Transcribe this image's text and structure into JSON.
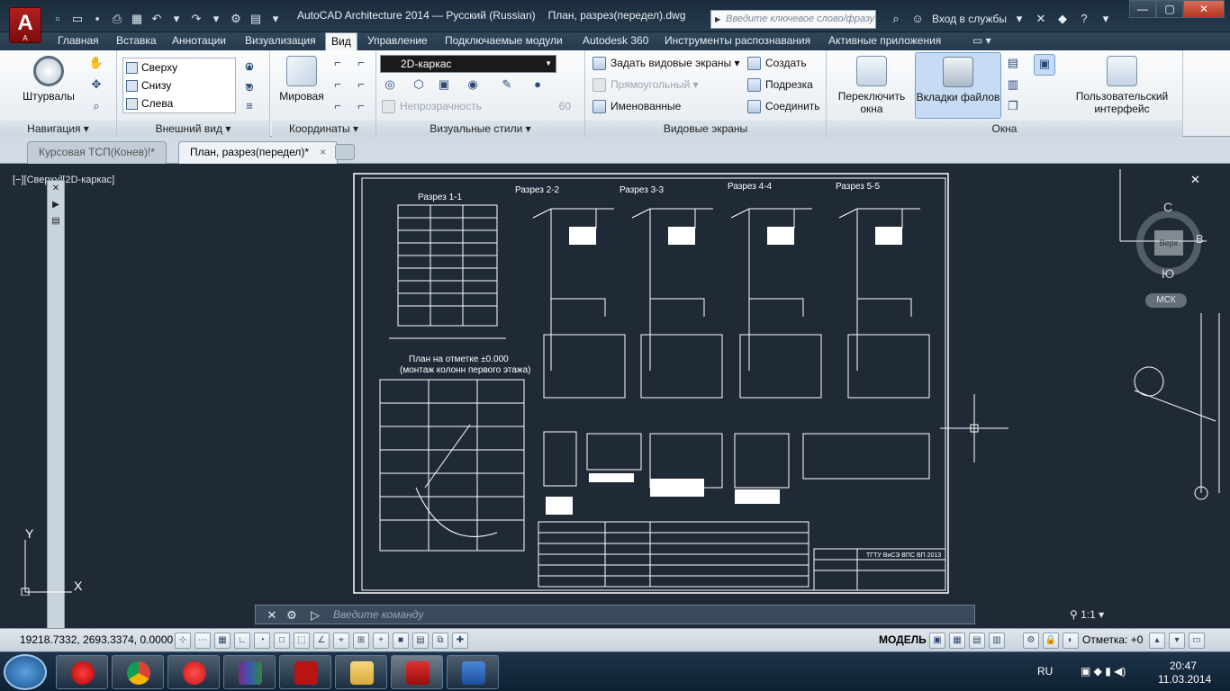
{
  "window": {
    "title": "AutoCAD Architecture 2014 — Русский (Russian)",
    "document": "План, разрез(передел).dwg",
    "logo_letter": "A",
    "search_placeholder": "Введите ключевое слово/фразу",
    "login_label": "Вход в службы"
  },
  "menu": [
    "Главная",
    "Вставка",
    "Аннотации",
    "Визуализация",
    "Вид",
    "Управление",
    "Подключаемые модули",
    "Autodesk 360",
    "Инструменты распознавания",
    "Активные приложения"
  ],
  "menu_active_index": 4,
  "ribbon": {
    "nav": {
      "label": "Навигация",
      "wheels": "Штурвалы"
    },
    "view": {
      "label": "Внешний вид",
      "items": [
        "Сверху",
        "Снизу",
        "Слева"
      ]
    },
    "coords": {
      "label": "Координаты",
      "world": "Мировая"
    },
    "visual": {
      "label": "Визуальные стили",
      "style": "2D-каркас",
      "opacity": "Непрозрачность",
      "opacity_value": "60"
    },
    "viewports": {
      "label": "Видовые экраны",
      "set": "Задать видовые экраны",
      "rect": "Прямоугольный",
      "named": "Именованные",
      "create": "Создать",
      "clip": "Подрезка",
      "join": "Соединить"
    },
    "window": {
      "label": "Окна",
      "switch": "Переключить окна",
      "file_tabs": "Вкладки файлов",
      "ui": "Пользовательский интерфейс"
    }
  },
  "tabs": [
    {
      "label": "Курсовая ТСП(Конев)!*",
      "active": false
    },
    {
      "label": "План, разрез(передел)*",
      "active": true
    }
  ],
  "viewport": {
    "label": "[−][Сверху][2D-каркас]"
  },
  "viewcube": {
    "north": "С",
    "south": "Ю",
    "east": "В",
    "top": "Верх",
    "ucs": "МСК"
  },
  "drawing": {
    "titles": [
      "Разрез 1-1",
      "Разрез 2-2",
      "Разрез 3-3",
      "Разрез 4-4",
      "Разрез 5-5"
    ],
    "plan_title": "План на отметке ±0.000",
    "plan_subtitle": "(монтаж колонн первого этажа)",
    "stamp": "ТГТУ ВиСЭ ВПС ВП 2013"
  },
  "command": {
    "prompt": "Введите команду"
  },
  "status": {
    "coords": "19218.7332, 2693.3374, 0.0000",
    "model": "МОДЕЛЬ",
    "scale": "1:1",
    "mark": "Отметка:",
    "mark_value": "+0"
  },
  "taskbar": {
    "lang": "RU",
    "time": "20:47",
    "date": "11.03.2014"
  },
  "colors": {
    "canvas": "#202a37",
    "drawing": "#ffffff",
    "accent": "#1b6ec2"
  }
}
